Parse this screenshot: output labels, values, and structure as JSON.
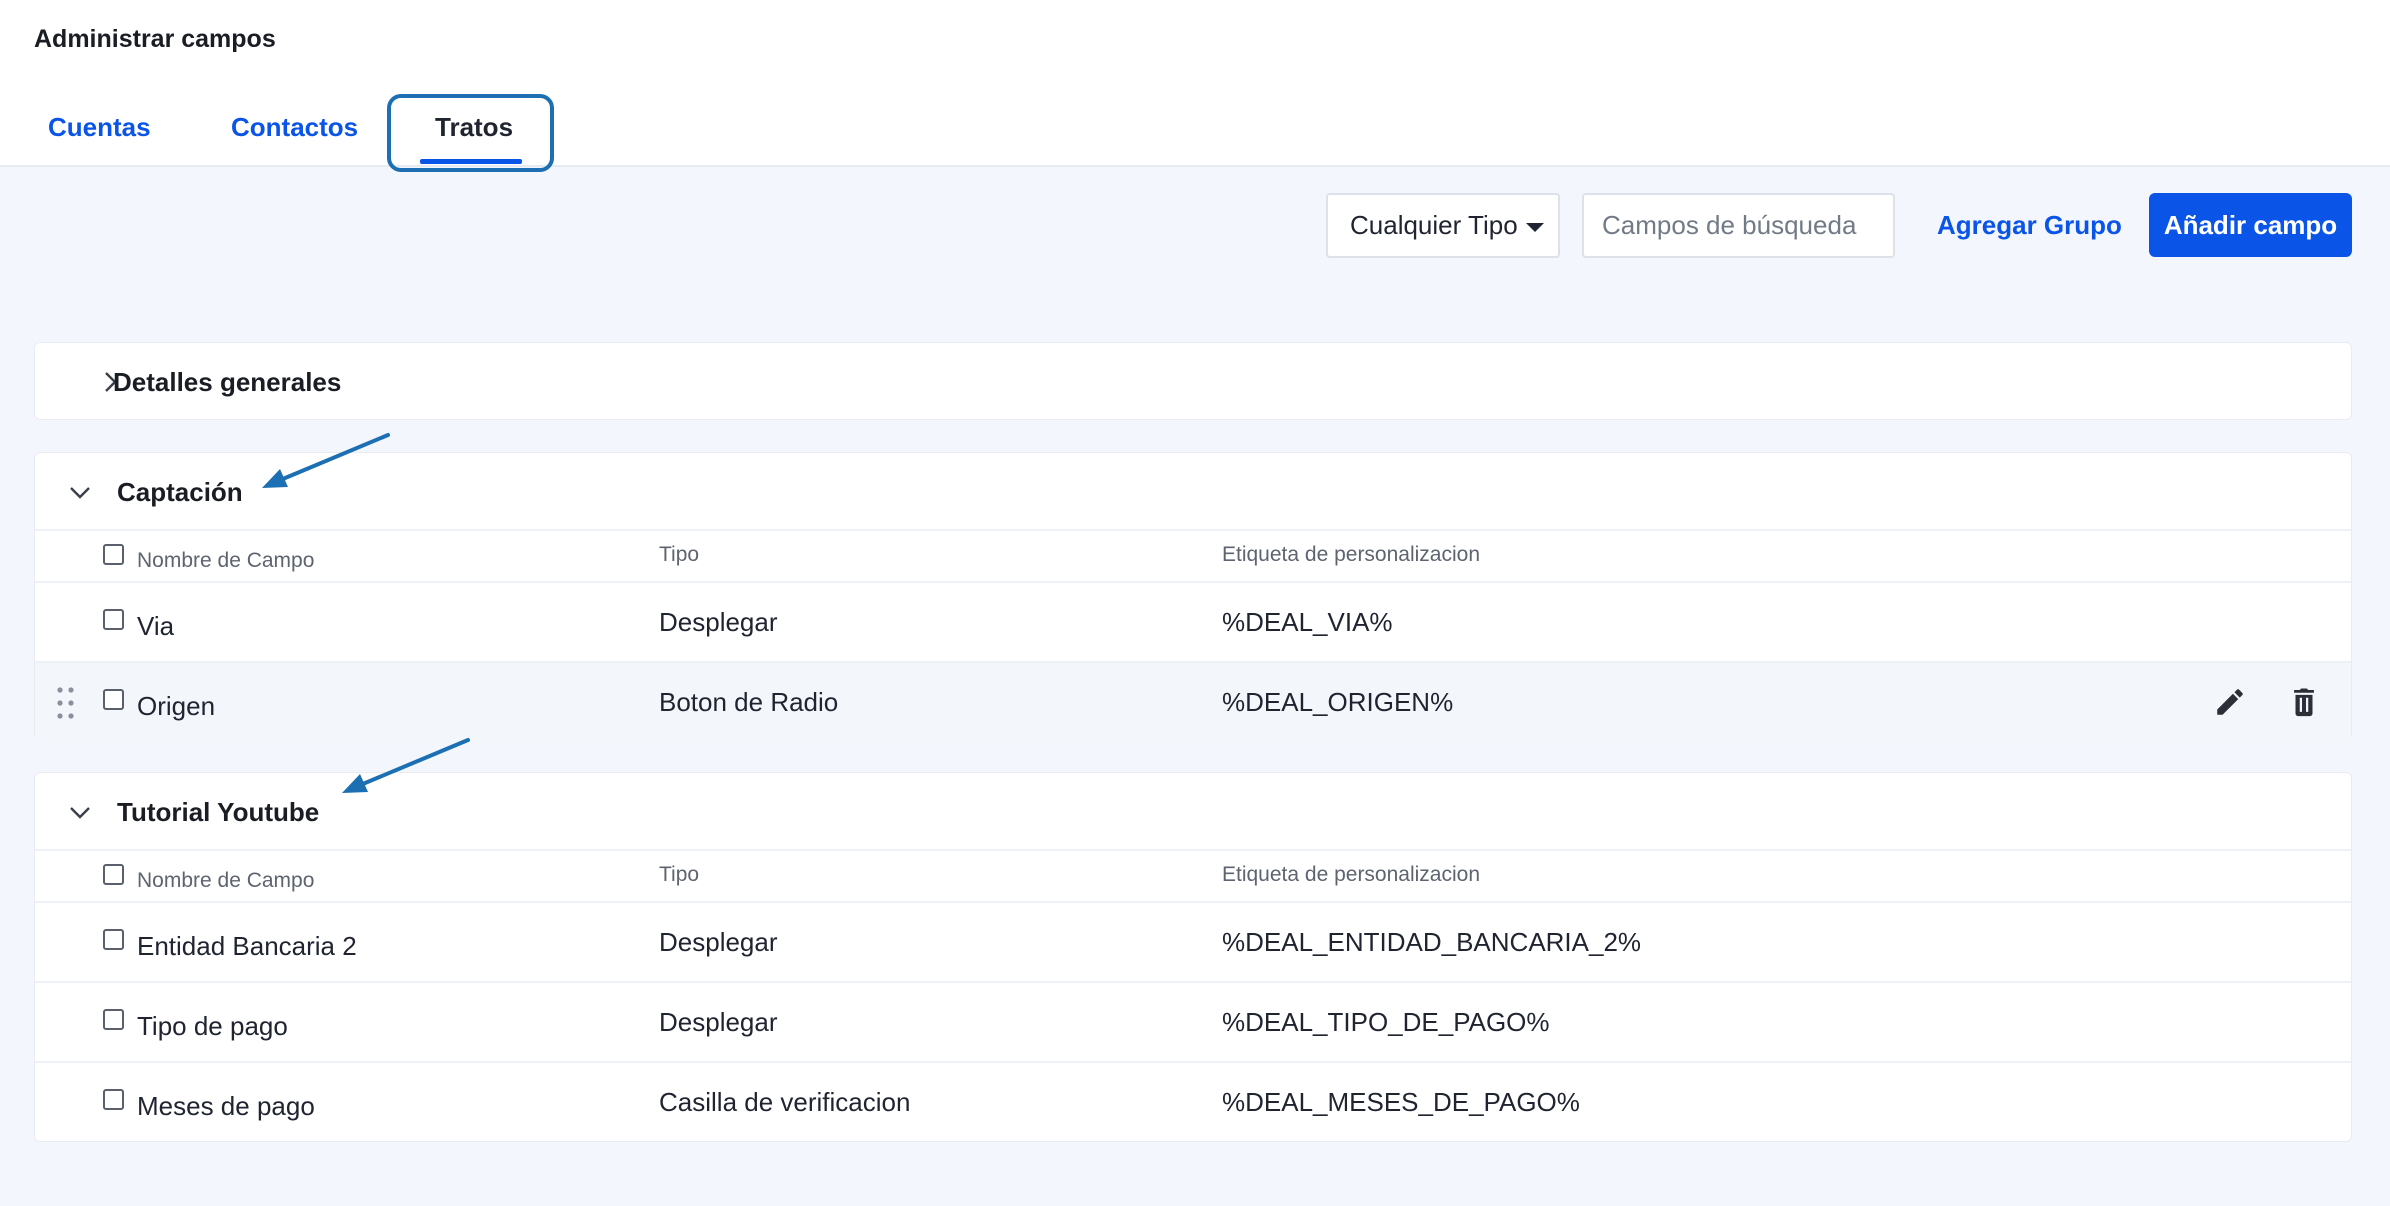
{
  "page": {
    "title": "Administrar campos"
  },
  "tabs": [
    {
      "label": "Cuentas",
      "active": false
    },
    {
      "label": "Contactos",
      "active": false
    },
    {
      "label": "Tratos",
      "active": true
    }
  ],
  "toolbar": {
    "type_filter": "Cualquier Tipo",
    "search_placeholder": "Campos de búsqueda",
    "add_group": "Agregar Grupo",
    "add_field": "Añadir campo"
  },
  "columns": {
    "name": "Nombre de Campo",
    "type": "Tipo",
    "tag": "Etiqueta de personalizacion"
  },
  "groups": [
    {
      "title": "Detalles generales",
      "expanded": false,
      "fields": []
    },
    {
      "title": "Captación",
      "expanded": true,
      "fields": [
        {
          "name": "Via",
          "type": "Desplegar",
          "tag": "%DEAL_VIA%"
        },
        {
          "name": "Origen",
          "type": "Boton de Radio",
          "tag": "%DEAL_ORIGEN%"
        }
      ]
    },
    {
      "title": "Tutorial Youtube",
      "expanded": true,
      "fields": [
        {
          "name": "Entidad Bancaria 2",
          "type": "Desplegar",
          "tag": "%DEAL_ENTIDAD_BANCARIA_2%"
        },
        {
          "name": "Tipo de pago",
          "type": "Desplegar",
          "tag": "%DEAL_TIPO_DE_PAGO%"
        },
        {
          "name": "Meses de pago",
          "type": "Casilla de verificacion",
          "tag": "%DEAL_MESES_DE_PAGO%"
        }
      ]
    }
  ],
  "colors": {
    "accent": "#0b54e8",
    "annotation_arrow": "#1c6fb2",
    "background": "#f3f6fc"
  },
  "icons": [
    "chevron-right-icon",
    "chevron-down-icon",
    "drag-handle-icon",
    "pencil-icon",
    "trash-icon",
    "caret-down-icon"
  ]
}
